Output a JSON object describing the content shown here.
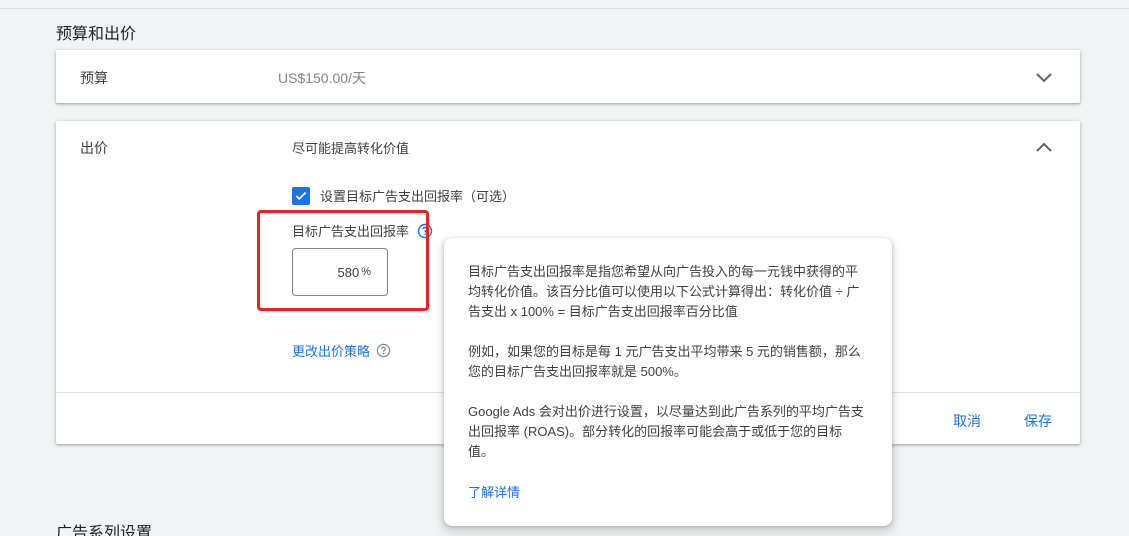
{
  "budget_section": {
    "title": "预算和出价",
    "budget_label": "预算",
    "budget_value": "US$150.00/天"
  },
  "bidding": {
    "label": "出价",
    "strategy": "尽可能提高转化价值",
    "checkbox_label": "设置目标广告支出回报率（可选）",
    "checkbox_checked": true,
    "roas_label": "目标广告支出回报率",
    "roas_value": "580",
    "roas_unit": "%",
    "change_link": "更改出价策略",
    "cancel": "取消",
    "save": "保存"
  },
  "tooltip": {
    "para1": "目标广告支出回报率是指您希望从向广告投入的每一元钱中获得的平均转化价值。该百分比值可以使用以下公式计算得出：转化价值 ÷ 广告支出 x 100% = 目标广告支出回报率百分比值",
    "para2": "例如，如果您的目标是每 1 元广告支出平均带来 5 元的销售额，那么您的目标广告支出回报率就是 500%。",
    "para3": "Google Ads 会对出价进行设置，以尽量达到此广告系列的平均广告支出回报率 (ROAS)。部分转化的回报率可能会高于或低于您的目标值。",
    "learn_more": "了解详情"
  },
  "campaign_section": {
    "title": "广告系列设置"
  },
  "colors": {
    "accent": "#1a73e8",
    "highlight": "#e8231d",
    "background": "#f1f3f4"
  },
  "icons": {
    "budget_expand": "chevron-down-icon",
    "bid_collapse": "chevron-up-icon",
    "checkbox": "check-icon",
    "roas_help": "help-circle-icon",
    "change_help": "help-circle-icon"
  }
}
